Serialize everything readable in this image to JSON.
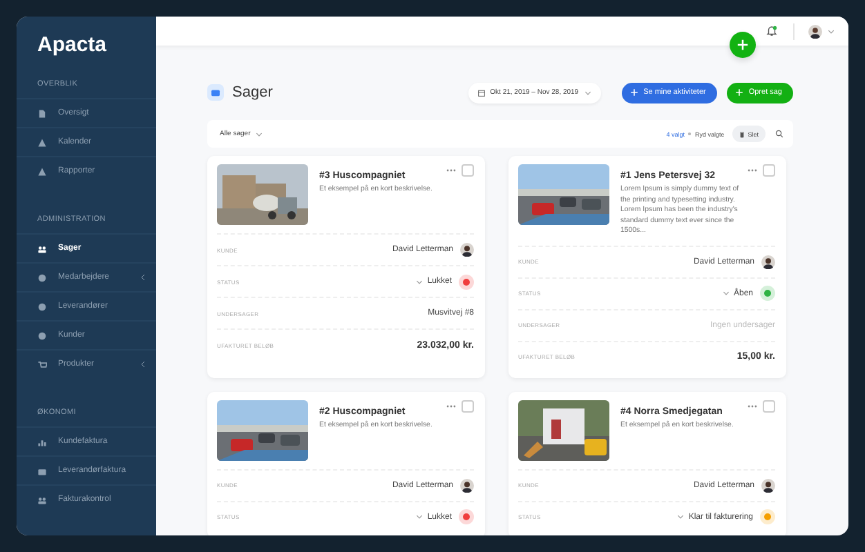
{
  "brand": "Apacta",
  "sidebar": {
    "sections": [
      {
        "heading": "OVERBLIK",
        "items": [
          {
            "label": "Oversigt",
            "selected": false,
            "submenu": false
          },
          {
            "label": "Kalender",
            "selected": false,
            "submenu": false
          },
          {
            "label": "Rapporter",
            "selected": false,
            "submenu": false
          }
        ]
      },
      {
        "heading": "ADMINISTRATION",
        "items": [
          {
            "label": "Sager",
            "selected": true,
            "submenu": false
          },
          {
            "label": "Medarbejdere",
            "selected": false,
            "submenu": true
          },
          {
            "label": "Leverandører",
            "selected": false,
            "submenu": false
          },
          {
            "label": "Kunder",
            "selected": false,
            "submenu": false
          },
          {
            "label": "Produkter",
            "selected": false,
            "submenu": true
          }
        ]
      },
      {
        "heading": "ØKONOMI",
        "items": [
          {
            "label": "Kundefaktura",
            "selected": false,
            "submenu": false
          },
          {
            "label": "Leverandørfaktura",
            "selected": false,
            "submenu": false
          },
          {
            "label": "Fakturakontrol",
            "selected": false,
            "submenu": false
          }
        ]
      }
    ]
  },
  "topbar": {
    "has_notification": true
  },
  "header": {
    "title": "Sager",
    "date_range": "Okt 21, 2019 – Nov 28, 2019",
    "buttons": [
      {
        "label": "Se mine aktiviteter",
        "kind": "primary"
      },
      {
        "label": "Opret sag",
        "kind": "success"
      }
    ]
  },
  "filter_bar": {
    "filter": "Alle sager",
    "selected_count": "4 valgt",
    "clear": "Ryd valgte",
    "delete": "Slet"
  },
  "cards": [
    {
      "title": "#3 Huscompagniet",
      "description": "Et eksempel på en kort beskrivelse.",
      "checked": false,
      "fields": [
        {
          "label": "KUNDE",
          "value": "David Letterman",
          "kind": "person"
        },
        {
          "label": "STATUS",
          "value": "Lukket",
          "kind": "status",
          "color": "#f03e3e"
        },
        {
          "label": "UNDERSAGER",
          "value": "Musvitvej #8",
          "kind": "text",
          "muted": false
        },
        {
          "label": "UFAKTURET BELØB",
          "value": "23.032,00 kr.",
          "kind": "amount"
        }
      ]
    },
    {
      "title": "#1 Jens Petersvej 32",
      "description": "Lorem Ipsum is simply dummy text of the printing and typesetting industry. Lorem Ipsum has been the industry's standard dummy text ever since the 1500s...",
      "checked": false,
      "fields": [
        {
          "label": "KUNDE",
          "value": "David Letterman",
          "kind": "person"
        },
        {
          "label": "STATUS",
          "value": "Åben",
          "kind": "status",
          "color": "#2fb344"
        },
        {
          "label": "UNDERSAGER",
          "value": "Ingen undersager",
          "kind": "text",
          "muted": true
        },
        {
          "label": "UFAKTURET BELØB",
          "value": "15,00 kr.",
          "kind": "amount"
        }
      ]
    },
    {
      "title": "#2 Huscompagniet",
      "description": "Et eksempel på en kort beskrivelse.",
      "checked": false,
      "fields": [
        {
          "label": "KUNDE",
          "value": "David Letterman",
          "kind": "person"
        },
        {
          "label": "STATUS",
          "value": "Lukket",
          "kind": "status",
          "color": "#f03e3e"
        }
      ]
    },
    {
      "title": "#4 Norra Smedjegatan",
      "description": "Et eksempel på en kort beskrivelse.",
      "checked": false,
      "fields": [
        {
          "label": "KUNDE",
          "value": "David Letterman",
          "kind": "person"
        },
        {
          "label": "STATUS",
          "value": "Klar til fakturering",
          "kind": "status",
          "color": "#f59f00"
        }
      ]
    }
  ]
}
